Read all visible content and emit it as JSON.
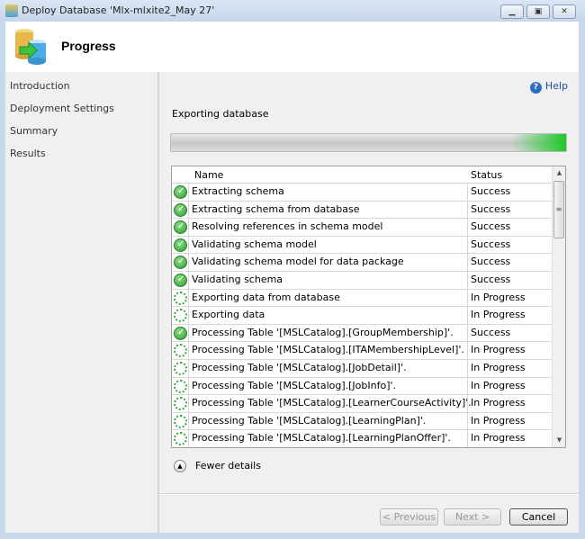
{
  "window": {
    "title": "Deploy Database 'Mlx-mlxite2_May 27'"
  },
  "header": {
    "title": "Progress"
  },
  "sidebar": {
    "items": [
      {
        "label": "Introduction"
      },
      {
        "label": "Deployment Settings"
      },
      {
        "label": "Summary"
      },
      {
        "label": "Results"
      }
    ]
  },
  "main": {
    "help_label": "Help",
    "subtitle": "Exporting database",
    "fewer_details_label": "Fewer details"
  },
  "table": {
    "columns": [
      "Name",
      "Status"
    ],
    "rows": [
      {
        "name": "Extracting schema",
        "status": "Success",
        "icon": "success"
      },
      {
        "name": "Extracting schema from database",
        "status": "Success",
        "icon": "success"
      },
      {
        "name": "Resolving references in schema model",
        "status": "Success",
        "icon": "success"
      },
      {
        "name": "Validating schema model",
        "status": "Success",
        "icon": "success"
      },
      {
        "name": "Validating schema model for data package",
        "status": "Success",
        "icon": "success"
      },
      {
        "name": "Validating schema",
        "status": "Success",
        "icon": "success"
      },
      {
        "name": "Exporting data from database",
        "status": "In Progress",
        "icon": "in-progress"
      },
      {
        "name": "Exporting data",
        "status": "In Progress",
        "icon": "in-progress"
      },
      {
        "name": "Processing Table '[MSLCatalog].[GroupMembership]'.",
        "status": "Success",
        "icon": "success"
      },
      {
        "name": "Processing Table '[MSLCatalog].[ITAMembershipLevel]'.",
        "status": "In Progress",
        "icon": "in-progress"
      },
      {
        "name": "Processing Table '[MSLCatalog].[JobDetail]'.",
        "status": "In Progress",
        "icon": "in-progress"
      },
      {
        "name": "Processing Table '[MSLCatalog].[JobInfo]'.",
        "status": "In Progress",
        "icon": "in-progress"
      },
      {
        "name": "Processing Table '[MSLCatalog].[LearnerCourseActivity]'.",
        "status": "In Progress",
        "icon": "in-progress"
      },
      {
        "name": "Processing Table '[MSLCatalog].[LearningPlan]'.",
        "status": "In Progress",
        "icon": "in-progress"
      },
      {
        "name": "Processing Table '[MSLCatalog].[LearningPlanOffer]'.",
        "status": "In Progress",
        "icon": "in-progress"
      }
    ]
  },
  "footer": {
    "previous_label": "< Previous",
    "next_label": "Next >",
    "cancel_label": "Cancel"
  }
}
